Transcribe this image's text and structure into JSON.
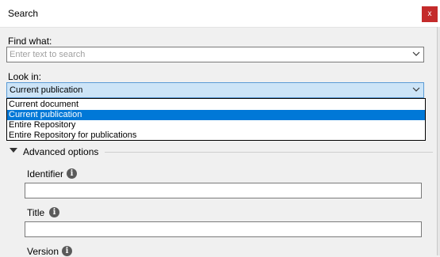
{
  "dialog": {
    "title": "Search",
    "close_label": "x"
  },
  "find_what": {
    "label": "Find what:",
    "value": "",
    "placeholder": "Enter text to search"
  },
  "look_in": {
    "label": "Look in:",
    "selected": "Current publication",
    "options": [
      {
        "label": "Current document",
        "selected": false
      },
      {
        "label": "Current publication",
        "selected": true
      },
      {
        "label": "Entire Repository",
        "selected": false
      },
      {
        "label": "Entire Repository for publications",
        "selected": false
      }
    ]
  },
  "advanced": {
    "label": "Advanced options",
    "expanded": true,
    "fields": [
      {
        "label": "Identifier",
        "value": ""
      },
      {
        "label": "Title",
        "value": ""
      },
      {
        "label": "Version",
        "value": ""
      }
    ]
  },
  "colors": {
    "accent": "#0078d7",
    "close": "#c42b2b",
    "focus_bg": "#cce4f7"
  }
}
